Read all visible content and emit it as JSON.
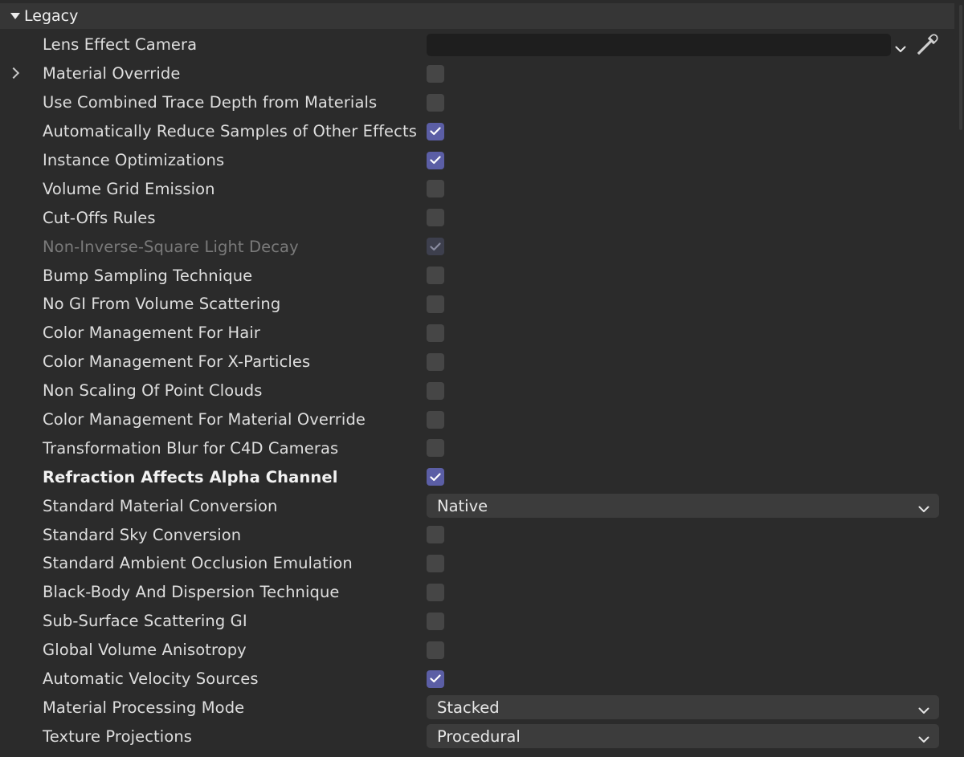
{
  "section": {
    "title": "Legacy"
  },
  "colors": {
    "background": "#2b2b2b",
    "header": "#363636",
    "checkbox_checked": "#5b5ea5",
    "checkbox_unchecked": "#464646",
    "dropdown": "#3c3c3c",
    "link_field": "#1e1e1e"
  },
  "rows": [
    {
      "label": "Lens Effect Camera",
      "control": "link",
      "value": ""
    },
    {
      "label": "Material Override",
      "control": "checkbox",
      "checked": false,
      "expandable": true
    },
    {
      "label": "Use Combined Trace Depth from Materials",
      "control": "checkbox",
      "checked": false
    },
    {
      "label": "Automatically Reduce Samples of Other Effects",
      "control": "checkbox",
      "checked": true
    },
    {
      "label": "Instance Optimizations",
      "control": "checkbox",
      "checked": true
    },
    {
      "label": "Volume Grid Emission",
      "control": "checkbox",
      "checked": false
    },
    {
      "label": "Cut-Offs Rules",
      "control": "checkbox",
      "checked": false
    },
    {
      "label": "Non-Inverse-Square Light Decay",
      "control": "checkbox",
      "checked": true,
      "disabled": true
    },
    {
      "label": "Bump Sampling Technique",
      "control": "checkbox",
      "checked": false
    },
    {
      "label": "No GI From Volume Scattering",
      "control": "checkbox",
      "checked": false
    },
    {
      "label": "Color Management For Hair",
      "control": "checkbox",
      "checked": false
    },
    {
      "label": "Color Management For X-Particles",
      "control": "checkbox",
      "checked": false
    },
    {
      "label": "Non Scaling Of Point Clouds",
      "control": "checkbox",
      "checked": false
    },
    {
      "label": "Color Management For Material Override",
      "control": "checkbox",
      "checked": false
    },
    {
      "label": "Transformation Blur for C4D Cameras",
      "control": "checkbox",
      "checked": false
    },
    {
      "label": "Refraction Affects Alpha Channel",
      "control": "checkbox",
      "checked": true,
      "bold": true
    },
    {
      "label": "Standard Material Conversion",
      "control": "dropdown",
      "value": "Native"
    },
    {
      "label": "Standard Sky Conversion",
      "control": "checkbox",
      "checked": false
    },
    {
      "label": "Standard Ambient Occlusion Emulation",
      "control": "checkbox",
      "checked": false
    },
    {
      "label": "Black-Body And Dispersion Technique",
      "control": "checkbox",
      "checked": false
    },
    {
      "label": "Sub-Surface Scattering GI",
      "control": "checkbox",
      "checked": false
    },
    {
      "label": "Global Volume Anisotropy",
      "control": "checkbox",
      "checked": false
    },
    {
      "label": "Automatic Velocity Sources",
      "control": "checkbox",
      "checked": true
    },
    {
      "label": "Material Processing Mode",
      "control": "dropdown",
      "value": "Stacked"
    },
    {
      "label": "Texture Projections",
      "control": "dropdown",
      "value": "Procedural"
    }
  ]
}
